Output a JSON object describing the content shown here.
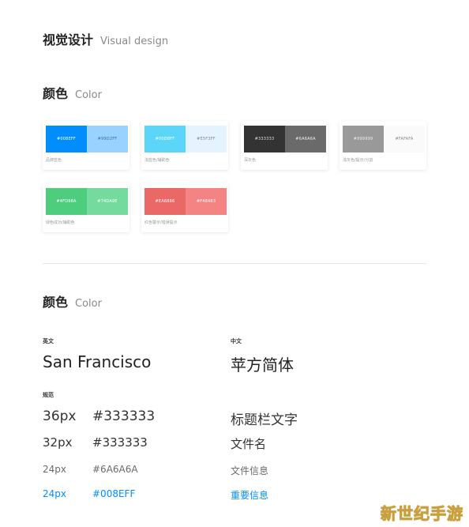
{
  "header": {
    "title_cn": "视觉设计",
    "title_en": "Visual design"
  },
  "color_section": {
    "title_cn": "颜色",
    "title_en": "Color",
    "cards": [
      {
        "label": "品牌蓝色",
        "swatches": [
          {
            "hex": "#008EFF",
            "color": "#008eff",
            "text_color": "#ffffff"
          },
          {
            "hex": "#99D2FF",
            "color": "#99d2ff",
            "text_color": "#3d6f99"
          }
        ]
      },
      {
        "label": "浅蓝色/辅助色",
        "swatches": [
          {
            "hex": "#00D8FF",
            "color": "#5cd6f8",
            "text_color": "#ffffff"
          },
          {
            "hex": "#E5F3FF",
            "color": "#e5f3ff",
            "text_color": "#7a8a99"
          }
        ]
      },
      {
        "label": "深灰色",
        "swatches": [
          {
            "hex": "#333333",
            "color": "#333333",
            "text_color": "#dddddd"
          },
          {
            "hex": "#6A6A6A",
            "color": "#6a6a6a",
            "text_color": "#eeeeee"
          }
        ]
      },
      {
        "label": "浅灰色/提示/分割",
        "swatches": [
          {
            "hex": "#999999",
            "color": "#999999",
            "text_color": "#eeeeee"
          },
          {
            "hex": "#FAFAFA",
            "color": "#fafafa",
            "text_color": "#888888"
          }
        ]
      },
      {
        "label": "绿色成功/辅助色",
        "swatches": [
          {
            "hex": "#4FD98A",
            "color": "#4fcd7f",
            "text_color": "#ffffff"
          },
          {
            "hex": "#74DA9E",
            "color": "#74da9e",
            "text_color": "#ffffff"
          }
        ]
      },
      {
        "label": "红色警示/错误提示",
        "swatches": [
          {
            "hex": "#EA6866",
            "color": "#ea6866",
            "text_color": "#ffffff"
          },
          {
            "hex": "#F48483",
            "color": "#f48483",
            "text_color": "#ffffff"
          }
        ]
      }
    ]
  },
  "font_section": {
    "title_cn": "颜色",
    "title_en": "Color",
    "en_label": "英文",
    "en_font": "San Francisco",
    "cn_label": "中文",
    "cn_font": "苹方简体",
    "spec_label": "规范",
    "rows": [
      {
        "size": "36px",
        "hex": "#333333",
        "usage": "标题栏文字"
      },
      {
        "size": "32px",
        "hex": "#333333",
        "usage": "文件名"
      },
      {
        "size": "24px",
        "hex": "#6A6A6A",
        "usage": "文件信息"
      },
      {
        "size": "24px",
        "hex": "#008EFF",
        "usage": "重要信息"
      }
    ]
  },
  "watermark": "新世纪手游"
}
